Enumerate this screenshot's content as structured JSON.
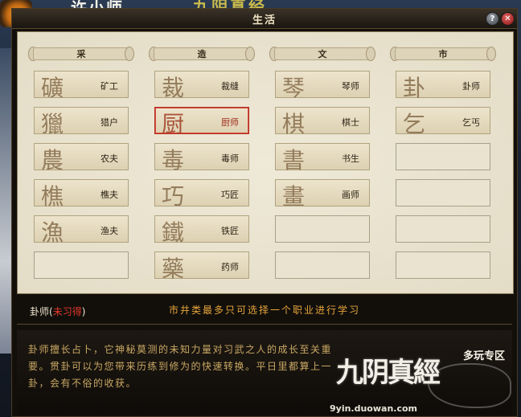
{
  "header": {
    "title": "生活",
    "help_label": "?",
    "close_label": "✕",
    "background_texts": [
      "许小师",
      "九阴真经"
    ]
  },
  "columns": [
    {
      "header": "采",
      "slots": [
        {
          "glyph": "礦",
          "name": "矿工"
        },
        {
          "glyph": "獵",
          "name": "猎户"
        },
        {
          "glyph": "農",
          "name": "农夫"
        },
        {
          "glyph": "樵",
          "name": "樵夫"
        },
        {
          "glyph": "漁",
          "name": "渔夫"
        },
        {
          "glyph": "",
          "name": ""
        }
      ]
    },
    {
      "header": "造",
      "slots": [
        {
          "glyph": "裁",
          "name": "裁缝"
        },
        {
          "glyph": "厨",
          "name": "厨师"
        },
        {
          "glyph": "毒",
          "name": "毒师"
        },
        {
          "glyph": "巧",
          "name": "巧匠"
        },
        {
          "glyph": "鐵",
          "name": "铁匠"
        },
        {
          "glyph": "藥",
          "name": "药师"
        }
      ]
    },
    {
      "header": "文",
      "slots": [
        {
          "glyph": "琴",
          "name": "琴师"
        },
        {
          "glyph": "棋",
          "name": "棋士"
        },
        {
          "glyph": "書",
          "name": "书生"
        },
        {
          "glyph": "畫",
          "name": "画师"
        },
        {
          "glyph": "",
          "name": ""
        },
        {
          "glyph": "",
          "name": ""
        }
      ]
    },
    {
      "header": "市",
      "slots": [
        {
          "glyph": "卦",
          "name": "卦师"
        },
        {
          "glyph": "乞",
          "name": "乞丐"
        },
        {
          "glyph": "",
          "name": ""
        },
        {
          "glyph": "",
          "name": ""
        },
        {
          "glyph": "",
          "name": ""
        },
        {
          "glyph": "",
          "name": ""
        }
      ]
    }
  ],
  "selected_profession": "厨师",
  "info": {
    "name": "卦师",
    "paren_open": "(",
    "status": "未习得",
    "paren_close": ")",
    "notice": "市井类最多只可选择一个职业进行学习",
    "description": "卦师擅长占卜，它神秘莫测的未知力量对习武之人的成长至关重要。贯卦可以为您带来历练到修为的快速转换。平日里都算上一卦，会有不俗的收获。"
  },
  "logo": {
    "title": "九阴真經",
    "zone": "多玩专区",
    "url": "9yin.duowan.com"
  },
  "colors": {
    "accent_orange": "#e6a43a",
    "status_red": "#e2382a",
    "selected_border": "#b32a1e",
    "parchment": "#e8e2cf"
  }
}
